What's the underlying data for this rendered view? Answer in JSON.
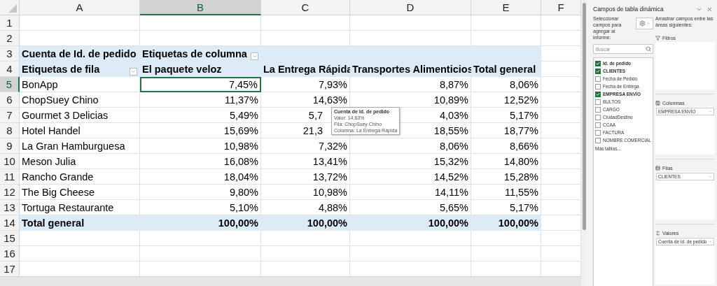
{
  "columns": [
    {
      "label": "A",
      "selected": false
    },
    {
      "label": "B",
      "selected": true
    },
    {
      "label": "C",
      "selected": false
    },
    {
      "label": "D",
      "selected": false
    },
    {
      "label": "E",
      "selected": false
    },
    {
      "label": "F",
      "selected": false
    }
  ],
  "rows": [
    {
      "number": "1",
      "selected": false,
      "kind": "empty"
    },
    {
      "number": "2",
      "selected": false,
      "kind": "empty"
    },
    {
      "number": "3",
      "selected": false,
      "kind": "title",
      "cells": [
        {
          "text": "Cuenta de Id. de pedido"
        },
        {
          "text": "Etiquetas de columna",
          "filter": true
        },
        {},
        {},
        {}
      ]
    },
    {
      "number": "4",
      "selected": false,
      "kind": "header",
      "cells": [
        {
          "text": "Etiquetas de fila",
          "filter": true
        },
        {
          "text": "El paquete veloz"
        },
        {
          "text": "La Entrega Rápida"
        },
        {
          "text": "Transportes Alimenticios"
        },
        {
          "text": "Total general"
        }
      ]
    },
    {
      "number": "5",
      "selected": true,
      "kind": "data",
      "cells": [
        {
          "text": "BonApp"
        },
        {
          "text": "7,45%",
          "selected": true
        },
        {
          "text": "7,93%"
        },
        {
          "text": "8,87%"
        },
        {
          "text": "8,06%"
        }
      ]
    },
    {
      "number": "6",
      "selected": false,
      "kind": "data",
      "cells": [
        {
          "text": "ChopSuey Chino"
        },
        {
          "text": "11,37%"
        },
        {
          "text": "14,63%"
        },
        {
          "text": "10,89%"
        },
        {
          "text": "12,52%"
        }
      ]
    },
    {
      "number": "7",
      "selected": false,
      "kind": "data",
      "cells": [
        {
          "text": "Gourmet 3 Delicias"
        },
        {
          "text": "5,49%"
        },
        {
          "text": "5,7",
          "covered": true
        },
        {
          "text": "4,03%"
        },
        {
          "text": "5,17%"
        }
      ]
    },
    {
      "number": "8",
      "selected": false,
      "kind": "data",
      "cells": [
        {
          "text": "Hotel Handel"
        },
        {
          "text": "15,69%"
        },
        {
          "text": "21,3",
          "covered": true
        },
        {
          "text": "18,55%"
        },
        {
          "text": "18,77%"
        }
      ]
    },
    {
      "number": "9",
      "selected": false,
      "kind": "data",
      "cells": [
        {
          "text": "La Gran Hamburguesa"
        },
        {
          "text": "10,98%"
        },
        {
          "text": "7,32%"
        },
        {
          "text": "8,06%"
        },
        {
          "text": "8,66%"
        }
      ]
    },
    {
      "number": "10",
      "selected": false,
      "kind": "data",
      "cells": [
        {
          "text": "Meson Julia"
        },
        {
          "text": "16,08%"
        },
        {
          "text": "13,41%"
        },
        {
          "text": "15,32%"
        },
        {
          "text": "14,80%"
        }
      ]
    },
    {
      "number": "11",
      "selected": false,
      "kind": "data",
      "cells": [
        {
          "text": "Rancho Grande"
        },
        {
          "text": "18,04%"
        },
        {
          "text": "13,72%"
        },
        {
          "text": "14,52%"
        },
        {
          "text": "15,28%"
        }
      ]
    },
    {
      "number": "12",
      "selected": false,
      "kind": "data",
      "cells": [
        {
          "text": "The Big Cheese"
        },
        {
          "text": "9,80%"
        },
        {
          "text": "10,98%"
        },
        {
          "text": "14,11%"
        },
        {
          "text": "11,55%"
        }
      ]
    },
    {
      "number": "13",
      "selected": false,
      "kind": "data",
      "cells": [
        {
          "text": "Tortuga Restaurante"
        },
        {
          "text": "5,10%"
        },
        {
          "text": "4,88%"
        },
        {
          "text": "5,65%"
        },
        {
          "text": "5,17%"
        }
      ]
    },
    {
      "number": "14",
      "selected": false,
      "kind": "total",
      "cells": [
        {
          "text": "Total general"
        },
        {
          "text": "100,00%"
        },
        {
          "text": "100,00%"
        },
        {
          "text": "100,00%"
        },
        {
          "text": "100,00%"
        }
      ]
    },
    {
      "number": "15",
      "selected": false,
      "kind": "empty"
    },
    {
      "number": "16",
      "selected": false,
      "kind": "empty"
    },
    {
      "number": "17",
      "selected": false,
      "kind": "empty"
    }
  ],
  "tooltip": {
    "title": "Cuenta de Id. de pedido",
    "lines": [
      "Valor: 14,63%",
      "Fila: ChopSuey Chino",
      "Columna: La Entrega Rápida"
    ]
  },
  "panel": {
    "title": "Campos de tabla dinámica",
    "instructions": "Seleccionar campos para agregar al informe:",
    "search": {
      "placeholder": "Buscar"
    },
    "fields": [
      {
        "label": "Id. de pedido",
        "checked": true
      },
      {
        "label": "CLIENTES",
        "checked": true
      },
      {
        "label": "Fecha de Pedido",
        "checked": false
      },
      {
        "label": "Fecha de Entrega",
        "checked": false
      },
      {
        "label": "EMPRESA ENVÍO",
        "checked": true
      },
      {
        "label": "BULTOS",
        "checked": false
      },
      {
        "label": "CARGO",
        "checked": false
      },
      {
        "label": "CiudadDestino",
        "checked": false
      },
      {
        "label": "CCAA",
        "checked": false
      },
      {
        "label": "FACTURA",
        "checked": false
      },
      {
        "label": "NOMBRE COMERCIAL",
        "checked": false
      }
    ],
    "more_tables": "Más tablas...",
    "drag_hint": "Arrastrar campos entre las áreas siguientes:",
    "areas": [
      {
        "name": "Filtros",
        "kind": "filters"
      },
      {
        "name": "Columnas",
        "kind": "columns",
        "items": [
          "EMPRESA ENVÍO"
        ]
      },
      {
        "name": "Filas",
        "kind": "rows",
        "items": [
          "CLIENTES"
        ]
      },
      {
        "name": "Valores",
        "kind": "values",
        "items": [
          "Cuenta de Id. de pedido"
        ]
      }
    ]
  }
}
